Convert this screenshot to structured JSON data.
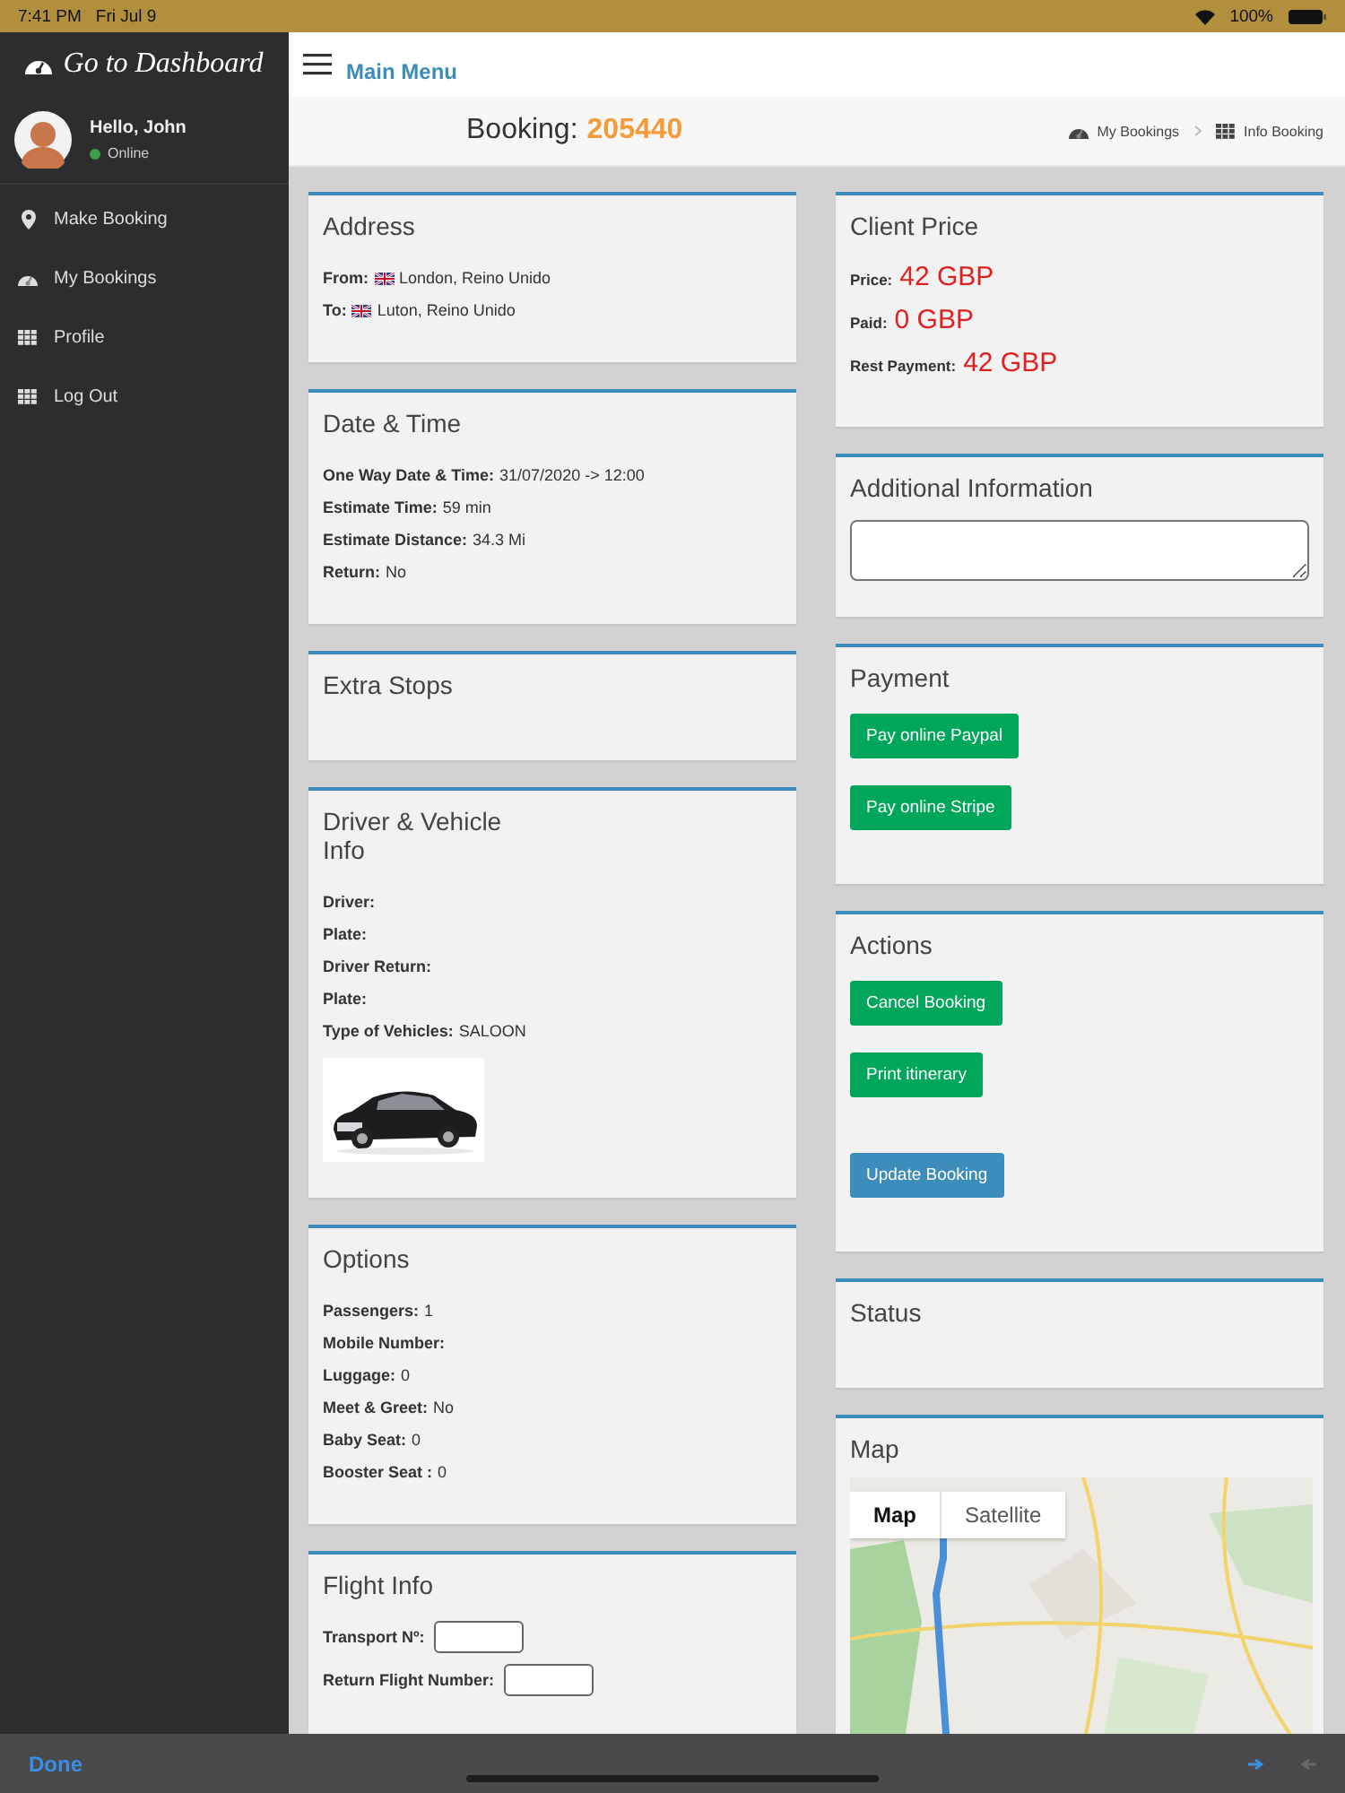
{
  "status_bar": {
    "time": "7:41 PM",
    "date": "Fri Jul 9",
    "battery": "100%"
  },
  "sidebar": {
    "brand": "Go to Dashboard",
    "user": {
      "greeting": "Hello, John",
      "status": "Online",
      "online": true
    },
    "items": [
      {
        "label": "Make Booking",
        "kind": "pin"
      },
      {
        "label": "My Bookings",
        "kind": "gauge"
      },
      {
        "label": "Profile",
        "kind": "grid"
      },
      {
        "label": "Log Out",
        "kind": "grid"
      }
    ]
  },
  "header": {
    "menu_label": "Main Menu"
  },
  "page": {
    "title": "Booking:",
    "booking_number": "205440",
    "breadcrumbs": [
      {
        "label": "My Bookings",
        "kind": "gauge"
      },
      {
        "label": "Info Booking",
        "kind": "grid"
      }
    ]
  },
  "left_cards": [
    {
      "title": "Address",
      "fields": [
        {
          "label": "From:",
          "value": "London, Reino Unido",
          "flag": true
        },
        {
          "label": "To:",
          "value": "Luton, Reino Unido",
          "flag": true
        }
      ]
    },
    {
      "title": "Date & Time",
      "fields": [
        {
          "label": "One Way Date & Time:",
          "value": "31/07/2020 -> 12:00"
        },
        {
          "label": "Estimate Time:",
          "value": "59 min"
        },
        {
          "label": "Estimate Distance:",
          "value": "34.3 Mi"
        },
        {
          "label": "Return:",
          "value": "No"
        }
      ]
    },
    {
      "title": "Extra Stops"
    },
    {
      "title": "Driver & Vehicle\nInfo",
      "fields": [
        {
          "label": "Driver:"
        },
        {
          "label": "Plate:"
        },
        {
          "label": "Driver Return:"
        },
        {
          "label": "Plate:"
        },
        {
          "label": "Type of Vehicles:",
          "value": "SALOON"
        }
      ],
      "picture": {
        "kind": "picture"
      }
    },
    {
      "title": "Options",
      "fields": [
        {
          "label": "Passengers:",
          "value": "1"
        },
        {
          "label": "Mobile Number:"
        },
        {
          "label": "Luggage:",
          "value": "0"
        },
        {
          "label": "Meet & Greet:",
          "value": "No"
        },
        {
          "label": "Baby Seat:",
          "value": "0"
        },
        {
          "label": "Booster Seat :",
          "value": "0"
        }
      ]
    },
    {
      "title": "Flight Info",
      "fields": [
        {
          "label": "Transport Nº:",
          "input": true
        },
        {
          "label": "Return Flight Number:",
          "input": true
        }
      ]
    }
  ],
  "right_cards": [
    {
      "title": "Client Price",
      "prices": [
        {
          "label": "Price:",
          "value": "42 GBP"
        },
        {
          "label": "Paid:",
          "value": "0 GBP"
        },
        {
          "label": "Rest Payment:",
          "value": "42 GBP"
        }
      ]
    },
    {
      "title": "Additional Information",
      "textarea": true
    },
    {
      "title": "Payment",
      "buttons": [
        {
          "label": "Pay online Paypal",
          "kind": "success"
        },
        {
          "label": "Pay online Stripe",
          "kind": "success"
        }
      ]
    },
    {
      "title": "Actions",
      "buttons": [
        {
          "label": "Cancel Booking",
          "kind": "success"
        },
        {
          "label": "Print itinerary",
          "kind": "success"
        },
        {
          "label": "Update Booking",
          "kind": "primary"
        }
      ]
    },
    {
      "title": "Status"
    },
    {
      "title": "Map",
      "map": {
        "kind": "picture",
        "map_types": [
          {
            "label": "Map",
            "selected": true
          },
          {
            "label": "Satellite",
            "selected": false
          }
        ]
      }
    }
  ],
  "bottom_bar": {
    "done_label": "Done"
  }
}
